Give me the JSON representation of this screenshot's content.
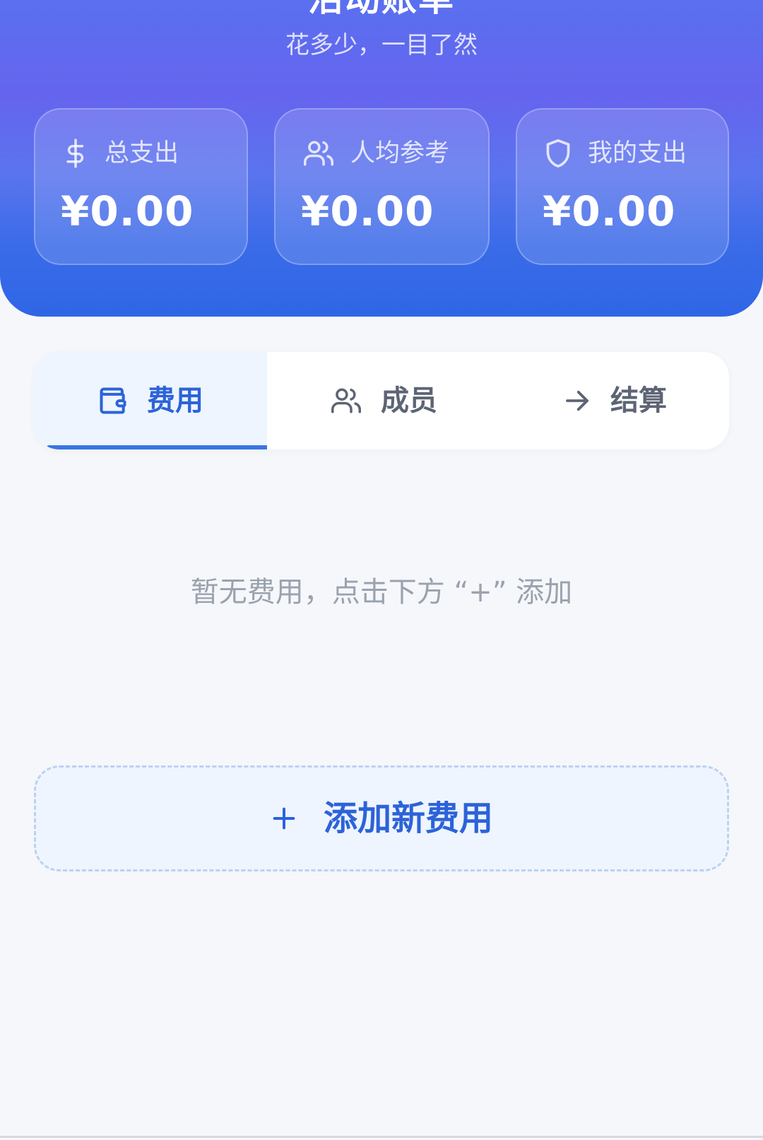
{
  "header": {
    "title": "活动账单",
    "subtitle": "花多少，一目了然"
  },
  "stats": [
    {
      "label": "总支出",
      "value": "¥0.00",
      "icon": "dollar-icon"
    },
    {
      "label": "人均参考",
      "value": "¥0.00",
      "icon": "users-icon"
    },
    {
      "label": "我的支出",
      "value": "¥0.00",
      "icon": "shield-icon"
    }
  ],
  "tabs": [
    {
      "label": "费用",
      "icon": "wallet-icon",
      "active": true
    },
    {
      "label": "成员",
      "icon": "users-icon",
      "active": false
    },
    {
      "label": "结算",
      "icon": "arrow-right-icon",
      "active": false
    }
  ],
  "empty_state": {
    "message": "暂无费用，点击下方 “+” 添加"
  },
  "add_button": {
    "label": "添加新费用",
    "icon": "plus-icon"
  },
  "colors": {
    "header_top": "#5a70f0",
    "header_bottom": "#2f66e6",
    "accent": "#2c63d8",
    "background": "#f5f7fb",
    "muted_text": "#9aa2ae"
  }
}
